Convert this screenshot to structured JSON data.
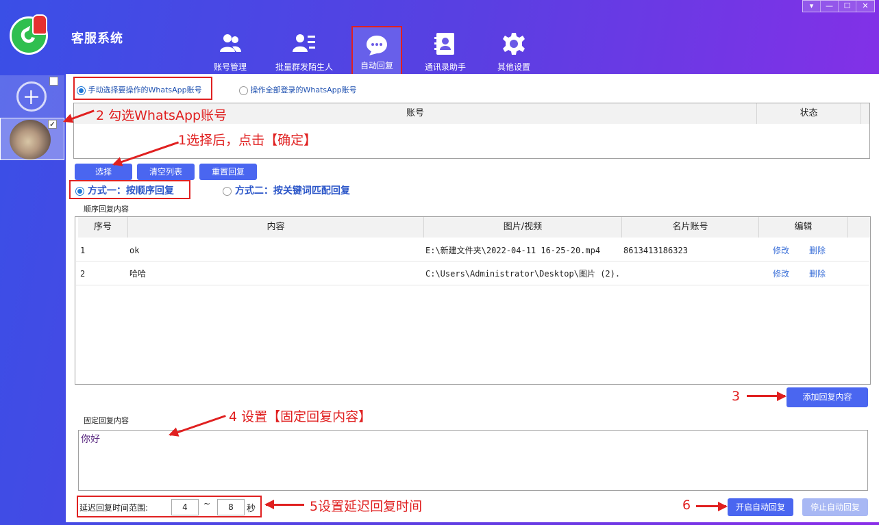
{
  "app": {
    "title": "客服系统"
  },
  "window_controls": [
    "▾",
    "—",
    "☐",
    "✕"
  ],
  "nav": [
    {
      "label": "账号管理",
      "icon": "users-icon"
    },
    {
      "label": "批量群发陌生人",
      "icon": "user-list-icon"
    },
    {
      "label": "自动回复",
      "icon": "chat-bubble-icon",
      "active": true
    },
    {
      "label": "通讯录助手",
      "icon": "contacts-book-icon"
    },
    {
      "label": "其他设置",
      "icon": "gear-icon"
    }
  ],
  "account_mode": {
    "manual": "手动选择要操作的WhatsApp账号",
    "all": "操作全部登录的WhatsApp账号",
    "selected": "manual"
  },
  "account_table": {
    "headers": [
      "账号",
      "状态"
    ],
    "rows": []
  },
  "account_buttons": {
    "select": "选择",
    "clear": "清空列表",
    "reset": "重置回复"
  },
  "reply_mode": {
    "mode1": "方式一：按顺序回复",
    "mode2": "方式二：按关键词匹配回复",
    "selected": "mode1"
  },
  "sequence": {
    "title": "顺序回复内容",
    "headers": [
      "序号",
      "内容",
      "图片/视频",
      "名片账号",
      "编辑"
    ],
    "rows": [
      {
        "no": "1",
        "content": "ok",
        "media": "E:\\新建文件夹\\2022-04-11 16-25-20.mp4",
        "card": "8613413186323",
        "edit": "修改",
        "delete": "删除"
      },
      {
        "no": "2",
        "content": "哈哈",
        "media": "C:\\Users\\Administrator\\Desktop\\图片 (2).",
        "card": "",
        "edit": "修改",
        "delete": "删除"
      }
    ],
    "add_button": "添加回复内容"
  },
  "fixed_reply": {
    "title": "固定回复内容",
    "value": "你好"
  },
  "delay": {
    "label": "延迟回复时间范围:",
    "min": "4",
    "sep": "~",
    "max": "8",
    "unit": "秒"
  },
  "control_buttons": {
    "start": "开启自动回复",
    "stop": "停止自动回复"
  },
  "annotations": {
    "a2": "2 勾选WhatsApp账号",
    "a1": "1选择后，点击【确定】",
    "a3": "3",
    "a4": "4 设置【固定回复内容】",
    "a5": "5设置延迟回复时间",
    "a6": "6"
  },
  "colors": {
    "accent": "#4a66f0",
    "annotation": "#e02020",
    "link": "#3a6fd8",
    "radio": "#1e78d8"
  }
}
